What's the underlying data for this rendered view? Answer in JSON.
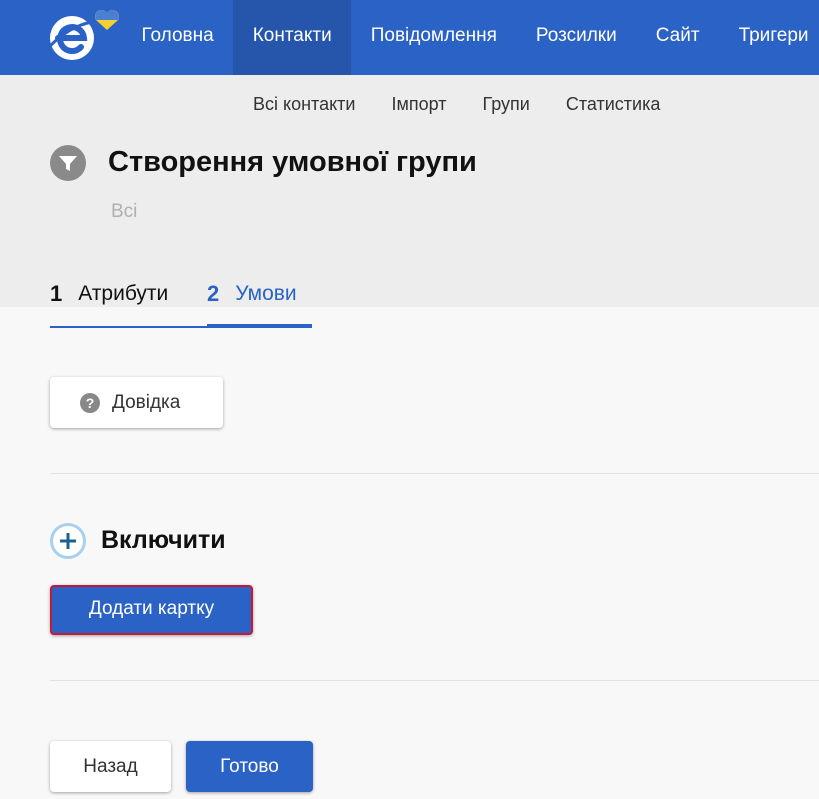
{
  "top_nav": {
    "items": [
      {
        "label": "Головна",
        "active": false
      },
      {
        "label": "Контакти",
        "active": true
      },
      {
        "label": "Повідомлення",
        "active": false
      },
      {
        "label": "Розсилки",
        "active": false
      },
      {
        "label": "Сайт",
        "active": false
      },
      {
        "label": "Тригери",
        "active": false
      }
    ]
  },
  "sub_nav": {
    "items": [
      "Всі контакти",
      "Імпорт",
      "Групи",
      "Статистика"
    ]
  },
  "header": {
    "title": "Створення умовної групи",
    "subtitle": "Всі"
  },
  "steps": [
    {
      "number": "1",
      "label": "Атрибути",
      "active": false
    },
    {
      "number": "2",
      "label": "Умови",
      "active": true
    }
  ],
  "help_button": {
    "label": "Довідка",
    "icon": "question-circle-icon"
  },
  "include_section": {
    "title": "Включити",
    "icon": "plus-circle-icon"
  },
  "add_card_button": {
    "label": "Додати картку"
  },
  "footer": {
    "back_label": "Назад",
    "done_label": "Готово"
  },
  "colors": {
    "brand_blue": "#2a63c5",
    "active_nav_bg": "#2556ac",
    "highlight_border": "#c4193b",
    "heart_blue": "#4a7fd4",
    "heart_yellow": "#f5d033"
  }
}
